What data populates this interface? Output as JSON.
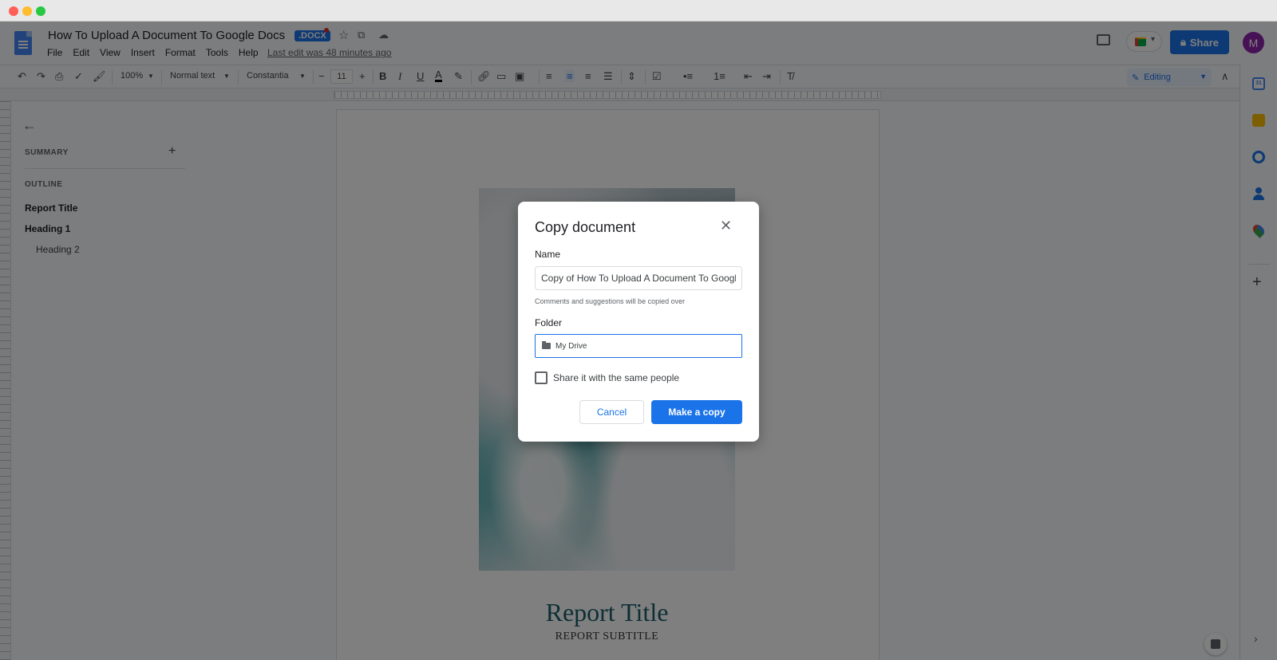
{
  "document": {
    "title": "How To Upload A Document To Google Docs",
    "badge": ".DOCX",
    "last_edit": "Last edit was 48 minutes ago"
  },
  "menu": [
    "File",
    "Edit",
    "View",
    "Insert",
    "Format",
    "Tools",
    "Help"
  ],
  "header": {
    "share_label": "Share",
    "avatar_initial": "M"
  },
  "toolbar": {
    "zoom": "100%",
    "style": "Normal text",
    "font": "Constantia",
    "font_size": "11",
    "mode": "Editing"
  },
  "outline": {
    "summary_label": "SUMMARY",
    "outline_label": "OUTLINE",
    "items": [
      {
        "label": "Report Title",
        "level": 1
      },
      {
        "label": "Heading 1",
        "level": 1
      },
      {
        "label": "Heading 2",
        "level": 2
      }
    ]
  },
  "page": {
    "title": "Report Title",
    "subtitle": "REPORT SUBTITLE"
  },
  "dialog": {
    "title": "Copy document",
    "name_label": "Name",
    "name_value": "Copy of How To Upload A Document To Google Docs",
    "note": "Comments and suggestions will be copied over",
    "folder_label": "Folder",
    "folder_value": "My Drive",
    "share_checkbox_label": "Share it with the same people",
    "share_checked": false,
    "cancel_label": "Cancel",
    "confirm_label": "Make a copy"
  },
  "colors": {
    "accent": "#1a73e8",
    "avatar": "#8e24aa",
    "report_title": "#1b5e6b"
  }
}
